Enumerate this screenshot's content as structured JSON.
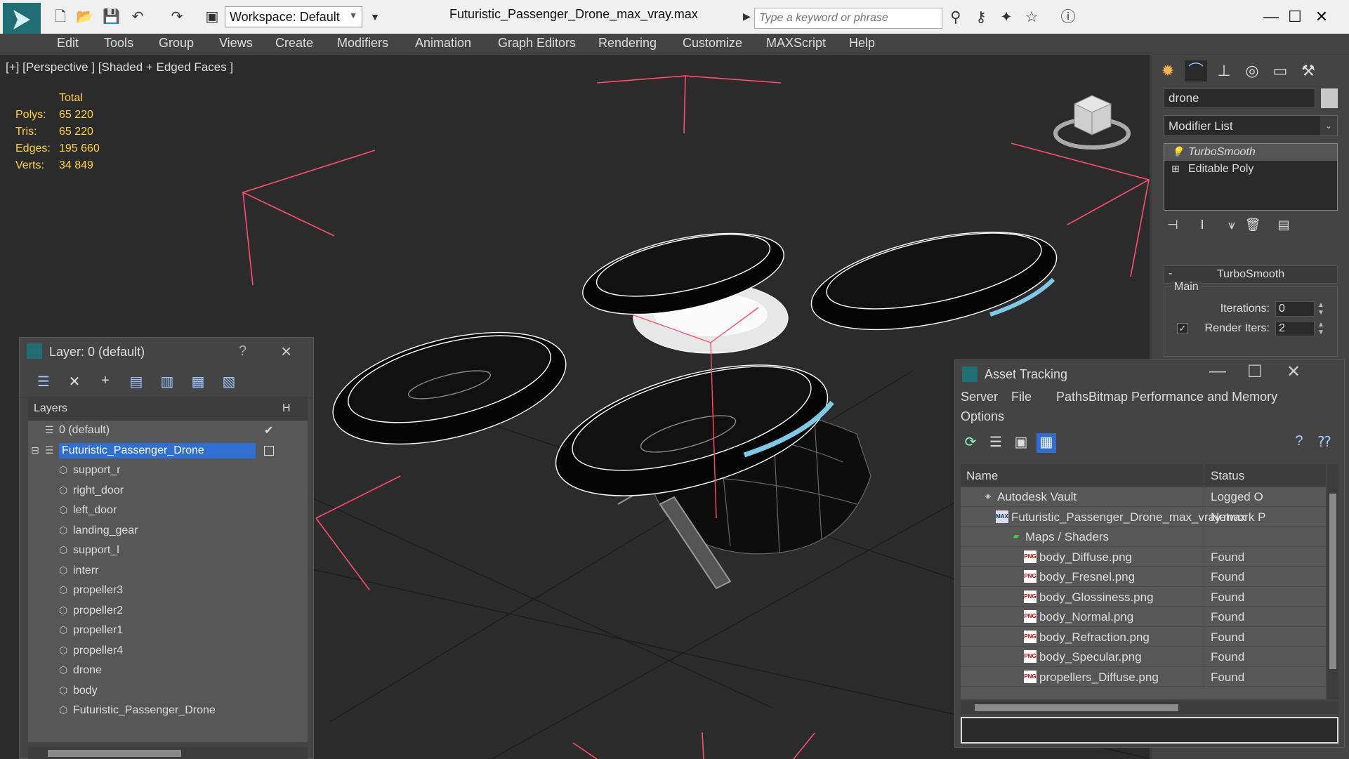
{
  "title_bar": {
    "document_title": "Futuristic_Passenger_Drone_max_vray.max",
    "workspace_label": "Workspace: Default",
    "search_placeholder": "Type a keyword or phrase",
    "quick_access_icons": [
      "new-file-icon",
      "open-file-icon",
      "save-icon",
      "undo-icon",
      "redo-icon",
      "project-icon"
    ],
    "tool_icons": [
      "binoculars-icon",
      "key-tools-icon",
      "infocenter-icon",
      "favorites-star-icon",
      "help-icon"
    ]
  },
  "menu": {
    "items": [
      "Edit",
      "Tools",
      "Group",
      "Views",
      "Create",
      "Modifiers",
      "Animation",
      "Graph Editors",
      "Rendering",
      "Customize",
      "MAXScript",
      "Help"
    ]
  },
  "viewport": {
    "label": "[+] [Perspective ] [Shaded + Edged Faces ]",
    "stats": {
      "header": "Total",
      "rows": [
        {
          "label": "Polys:",
          "value": "65 220"
        },
        {
          "label": "Tris:",
          "value": "65 220"
        },
        {
          "label": "Edges:",
          "value": "195 660"
        },
        {
          "label": "Verts:",
          "value": "34 849"
        }
      ]
    },
    "stats_color": "#ffd23c",
    "selection_bracket_color": "#ff4d6d"
  },
  "command_panel": {
    "tabs": [
      "create-icon",
      "modify-icon",
      "hierarchy-icon",
      "motion-icon",
      "display-icon",
      "utilities-icon"
    ],
    "object_name": "drone",
    "modifier_list_label": "Modifier List",
    "stack": [
      {
        "label": "TurboSmooth",
        "selected": true
      },
      {
        "label": "Editable Poly",
        "selected": false
      }
    ],
    "rollout_title": "TurboSmooth",
    "group_main": "Main",
    "iterations_label": "Iterations:",
    "iterations_value": "0",
    "render_iters_label": "Render Iters:",
    "render_iters_value": "2"
  },
  "layer_dialog": {
    "title": "Layer: 0 (default)",
    "help": "?",
    "column_layers": "Layers",
    "column_hide": "H",
    "rows": [
      {
        "name": "0 (default)",
        "level": 0,
        "type": "layer",
        "current": true
      },
      {
        "name": "Futuristic_Passenger_Drone",
        "level": 0,
        "type": "layer",
        "selected": true
      },
      {
        "name": "support_r",
        "level": 1,
        "type": "object"
      },
      {
        "name": "right_door",
        "level": 1,
        "type": "object"
      },
      {
        "name": "left_door",
        "level": 1,
        "type": "object"
      },
      {
        "name": "landing_gear",
        "level": 1,
        "type": "object"
      },
      {
        "name": "support_l",
        "level": 1,
        "type": "object"
      },
      {
        "name": "interr",
        "level": 1,
        "type": "object"
      },
      {
        "name": "propeller3",
        "level": 1,
        "type": "object"
      },
      {
        "name": "propeller2",
        "level": 1,
        "type": "object"
      },
      {
        "name": "propeller1",
        "level": 1,
        "type": "object"
      },
      {
        "name": "propeller4",
        "level": 1,
        "type": "object"
      },
      {
        "name": "drone",
        "level": 1,
        "type": "object"
      },
      {
        "name": "body",
        "level": 1,
        "type": "object"
      },
      {
        "name": "Futuristic_Passenger_Drone",
        "level": 1,
        "type": "object"
      }
    ]
  },
  "asset_dialog": {
    "title": "Asset Tracking",
    "menu": [
      "Server",
      "File",
      "Paths",
      "Bitmap Performance and Memory",
      "Options"
    ],
    "column_name": "Name",
    "column_status": "Status",
    "rows": [
      {
        "name": "Autodesk Vault",
        "status": "Logged O",
        "level": 0,
        "icon": "vault-icon"
      },
      {
        "name": "Futuristic_Passenger_Drone_max_vray.max",
        "status": "Network P",
        "level": 1,
        "icon": "max-file-icon"
      },
      {
        "name": "Maps / Shaders",
        "status": "",
        "level": 2,
        "icon": "maps-folder-icon"
      },
      {
        "name": "body_Diffuse.png",
        "status": "Found",
        "level": 3,
        "icon": "png-icon"
      },
      {
        "name": "body_Fresnel.png",
        "status": "Found",
        "level": 3,
        "icon": "png-icon"
      },
      {
        "name": "body_Glossiness.png",
        "status": "Found",
        "level": 3,
        "icon": "png-icon"
      },
      {
        "name": "body_Normal.png",
        "status": "Found",
        "level": 3,
        "icon": "png-icon"
      },
      {
        "name": "body_Refraction.png",
        "status": "Found",
        "level": 3,
        "icon": "png-icon"
      },
      {
        "name": "body_Specular.png",
        "status": "Found",
        "level": 3,
        "icon": "png-icon"
      },
      {
        "name": "propellers_Diffuse.png",
        "status": "Found",
        "level": 3,
        "icon": "png-icon"
      }
    ]
  }
}
